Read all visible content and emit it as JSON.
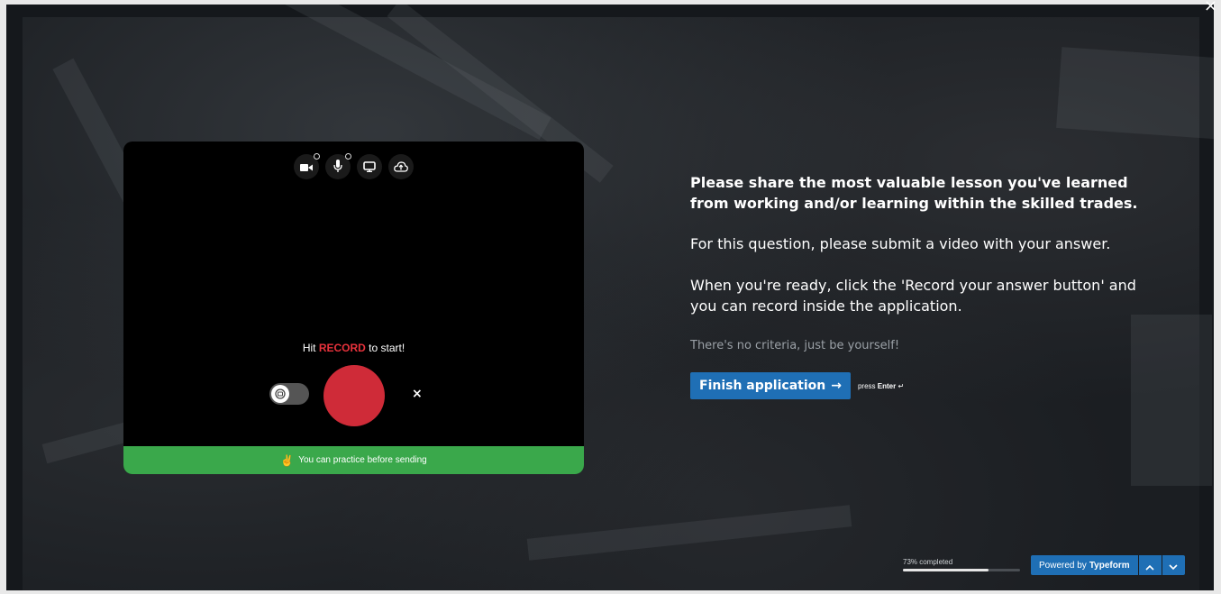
{
  "window": {
    "close_icon": "×"
  },
  "recorder": {
    "toolbar": [
      {
        "name": "camera-icon"
      },
      {
        "name": "microphone-icon"
      },
      {
        "name": "screen-icon"
      },
      {
        "name": "cloud-upload-icon"
      }
    ],
    "hint_prefix": "Hit ",
    "hint_accent": "RECORD",
    "hint_suffix": " to start!",
    "cancel_icon": "×",
    "practice_emoji": "✌",
    "practice_text": "You can practice before sending",
    "colors": {
      "record": "#cf2b38",
      "practice": "#3aa84b",
      "accent": "#e8323c"
    }
  },
  "question": {
    "title": "Please share the most valuable lesson you've learned from working and/or learning within the skilled trades.",
    "line1": "For this question, please submit a video with your answer.",
    "line2": "When you're ready, click the 'Record your answer button' and you can record inside the application.",
    "note": "There's no criteria, just be yourself!",
    "finish_label": "Finish application",
    "finish_arrow": "→",
    "press_prefix": "press",
    "press_key": "Enter",
    "press_symbol": "↵"
  },
  "footer": {
    "progress_label": "73% completed",
    "progress_value": 0.73,
    "powered_prefix": "Powered by",
    "powered_brand": "Typeform",
    "accent": "#1f6fb5"
  }
}
